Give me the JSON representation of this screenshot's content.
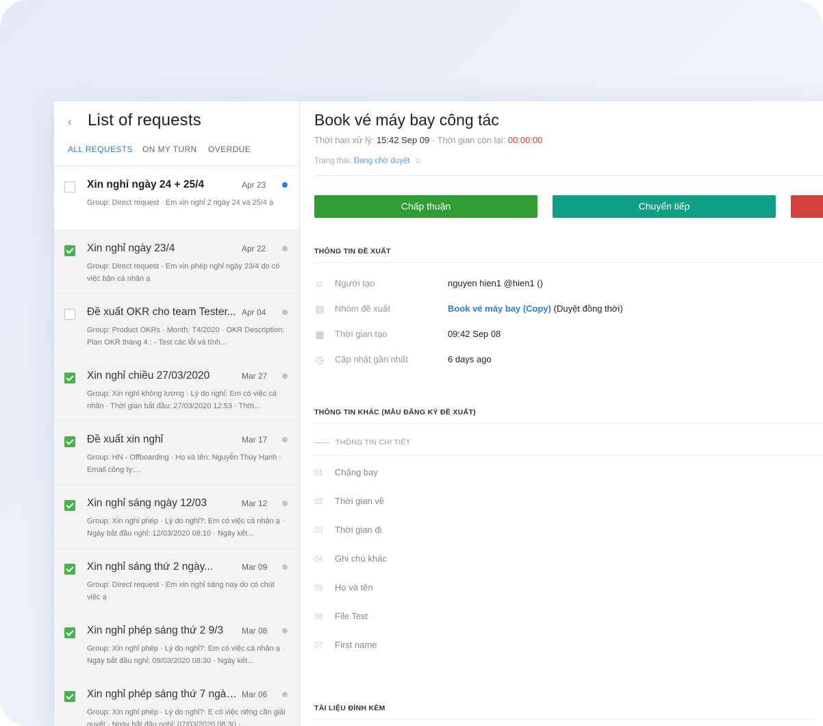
{
  "sidebar": {
    "title": "List of requests",
    "tabs": [
      {
        "label": "ALL REQUESTS",
        "active": true
      },
      {
        "label": "ON MY TURN",
        "active": false
      },
      {
        "label": "OVERDUE",
        "active": false
      }
    ],
    "requests": [
      {
        "title": "Xin nghỉ ngày 24 + 25/4",
        "date": "Apr 23",
        "desc": "Group: Direct request · Em xin nghỉ 2 ngày 24 và 25/4 ạ",
        "checked": false,
        "unread": true
      },
      {
        "title": "Xin nghỉ ngày 23/4",
        "date": "Apr 22",
        "desc": "Group: Direct request · Em xin phép nghỉ ngày 23/4 do có việc bận cá nhân ạ",
        "checked": true,
        "unread": false
      },
      {
        "title": "Đề xuất OKR cho team Tester...",
        "date": "Apr 04",
        "desc": "Group: Product OKRs · Month: T4/2020 · OKR Description: Plan OKR tháng 4 : - Test các lỗi và tính...",
        "checked": false,
        "unread": false
      },
      {
        "title": "Xin nghỉ chiều 27/03/2020",
        "date": "Mar 27",
        "desc": "Group: Xin nghỉ không lương · Lý do nghỉ: Em có việc cá nhân · Thời gian bắt đầu: 27/03/2020 12:53 · Thời...",
        "checked": true,
        "unread": false
      },
      {
        "title": "Đề xuất xin nghỉ",
        "date": "Mar 17",
        "desc": "Group: HN - Offboarding · Họ và tên: Nguyễn Thúy Hạnh · Email công ty:...",
        "checked": true,
        "unread": false
      },
      {
        "title": "Xin nghỉ sáng ngày 12/03",
        "date": "Mar 12",
        "desc": "Group: Xin nghỉ phép · Lý do nghỉ?: Em có việc cá nhân ạ · Ngày bắt đầu nghỉ: 12/03/2020 08:10 · Ngày kết...",
        "checked": true,
        "unread": false
      },
      {
        "title": "Xin nghỉ sáng thứ 2 ngày...",
        "date": "Mar 09",
        "desc": "Group: Direct request · Em xin nghỉ sáng nay do có chút việc ạ",
        "checked": true,
        "unread": false
      },
      {
        "title": "Xin nghỉ phép sáng thứ 2 9/3",
        "date": "Mar 08",
        "desc": "Group: Xin nghỉ phép · Lý do nghỉ?: Em có việc cá nhân ạ · Ngày bắt đầu nghỉ: 09/03/2020 08:30 · Ngày kết...",
        "checked": true,
        "unread": false
      },
      {
        "title": "Xin nghỉ phép sáng thứ 7 ngày...",
        "date": "Mar 06",
        "desc": "Group: Xin nghỉ phép · Lý do nghỉ?: E có việc riêng cần giải quyết · Ngày bắt đầu nghỉ: 07/03/2020 08:30 ·...",
        "checked": true,
        "unread": false
      }
    ]
  },
  "detail": {
    "title": "Book vé máy bay công tác",
    "deadline_label": "Thời hạn xử lý:",
    "deadline_value": "15:42 Sep 09",
    "remaining_label": "· Thời gian còn lại:",
    "remaining_value": "00:00:00",
    "status_label": "Trạng thái:",
    "status_value": "Đang chờ duyệt",
    "approve_label": "Chấp thuận",
    "forward_label": "Chuyển tiếp",
    "section_info": "THÔNG TIN ĐỀ XUẤT",
    "creator_label": "Người tạo",
    "creator_value": "nguyen hien1 @hien1 ()",
    "group_label": "Nhóm đề xuất",
    "group_link": "Book vé máy bay (Copy)",
    "group_suffix": "(Duyệt đồng thời)",
    "created_label": "Thời gian tạo",
    "created_value": "09:42 Sep 08",
    "updated_label": "Cập nhật gần nhất",
    "updated_value": "6 days ago",
    "section_other": "THÔNG TIN KHÁC (MẪU ĐĂNG KÝ ĐỀ XUẤT)",
    "subsection": "THÔNG TIN CHI TIẾT",
    "fields": [
      {
        "num": "01",
        "label": "Chặng bay"
      },
      {
        "num": "02",
        "label": "Thời gian về"
      },
      {
        "num": "03",
        "label": "Thời gian đi"
      },
      {
        "num": "04",
        "label": "Ghi chú khác"
      },
      {
        "num": "05",
        "label": "Họ và tên"
      },
      {
        "num": "06",
        "label": "File Test"
      },
      {
        "num": "07",
        "label": "First name"
      }
    ],
    "section_attach": "TÀI LIỆU ĐÍNH KÈM"
  },
  "colors": {
    "accent": "#2b7be4",
    "approve": "#2e9e34",
    "forward": "#0f9f85",
    "reject": "#d23f3c",
    "checkbox_green": "#4caf50",
    "countdown_red": "#e53935"
  }
}
